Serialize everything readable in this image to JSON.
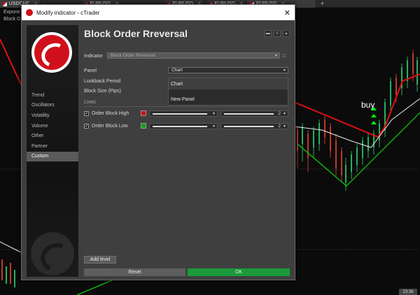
{
  "tabs": [
    {
      "label": "USDCHF",
      "active": true
    },
    {
      "label": "EURUSD",
      "active": false
    },
    {
      "label": "EURUSD",
      "active": false
    },
    {
      "label": "EURUSD",
      "active": false
    },
    {
      "label": "EURUSD",
      "active": false
    }
  ],
  "chart": {
    "labels": [
      "Expone",
      "Block O"
    ],
    "buy_label": "buy",
    "time_badge": "23:38"
  },
  "dialog": {
    "title": "Modify indicator - cTrader",
    "header_title": "Block Order Rreversal",
    "nav": [
      "Trend",
      "Oscillators",
      "Volatility",
      "Volume",
      "Other",
      "Partner",
      "Custom"
    ],
    "nav_selected": "Custom",
    "fields": {
      "indicator_label": "Indicator",
      "indicator_value": "Block Order Rreversal",
      "panel_label": "Panel",
      "panel_value": "Chart",
      "lookback_label": "Lookback Period",
      "block_size_label": "Block Size (Pips)"
    },
    "panel_options": [
      "Chart",
      "New Panel"
    ],
    "lines_section": "Lines",
    "lines": [
      {
        "label": "Order Block High",
        "color": "#d01010",
        "width": "2"
      },
      {
        "label": "Order Block Low",
        "color": "#10a010",
        "width": "2"
      }
    ],
    "add_level": "Add level",
    "reset": "Reset",
    "ok": "OK"
  },
  "colors": {
    "ok": "#1a9a3a",
    "reset": "#5e5e5e",
    "accent": "#d0101a"
  }
}
